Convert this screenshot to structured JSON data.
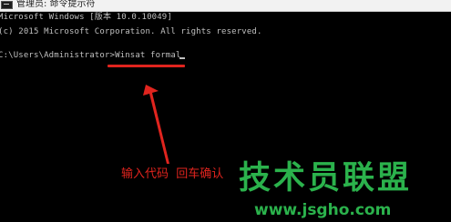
{
  "window": {
    "title": "管理员: 命令提示符",
    "icon": "cmd-console-icon"
  },
  "console": {
    "lines": [
      "Microsoft Windows [版本 10.0.10049]",
      "(c) 2015 Microsoft Corporation. All rights reserved.",
      "",
      "C:\\Users\\Administrator>Winsat formal"
    ]
  },
  "annotation": {
    "text": "输入代码  回车确认",
    "color": "#e0241e"
  },
  "watermark": {
    "brand": "技术员联盟",
    "url": "www.jsgho.com",
    "color": "#2bb24c"
  }
}
